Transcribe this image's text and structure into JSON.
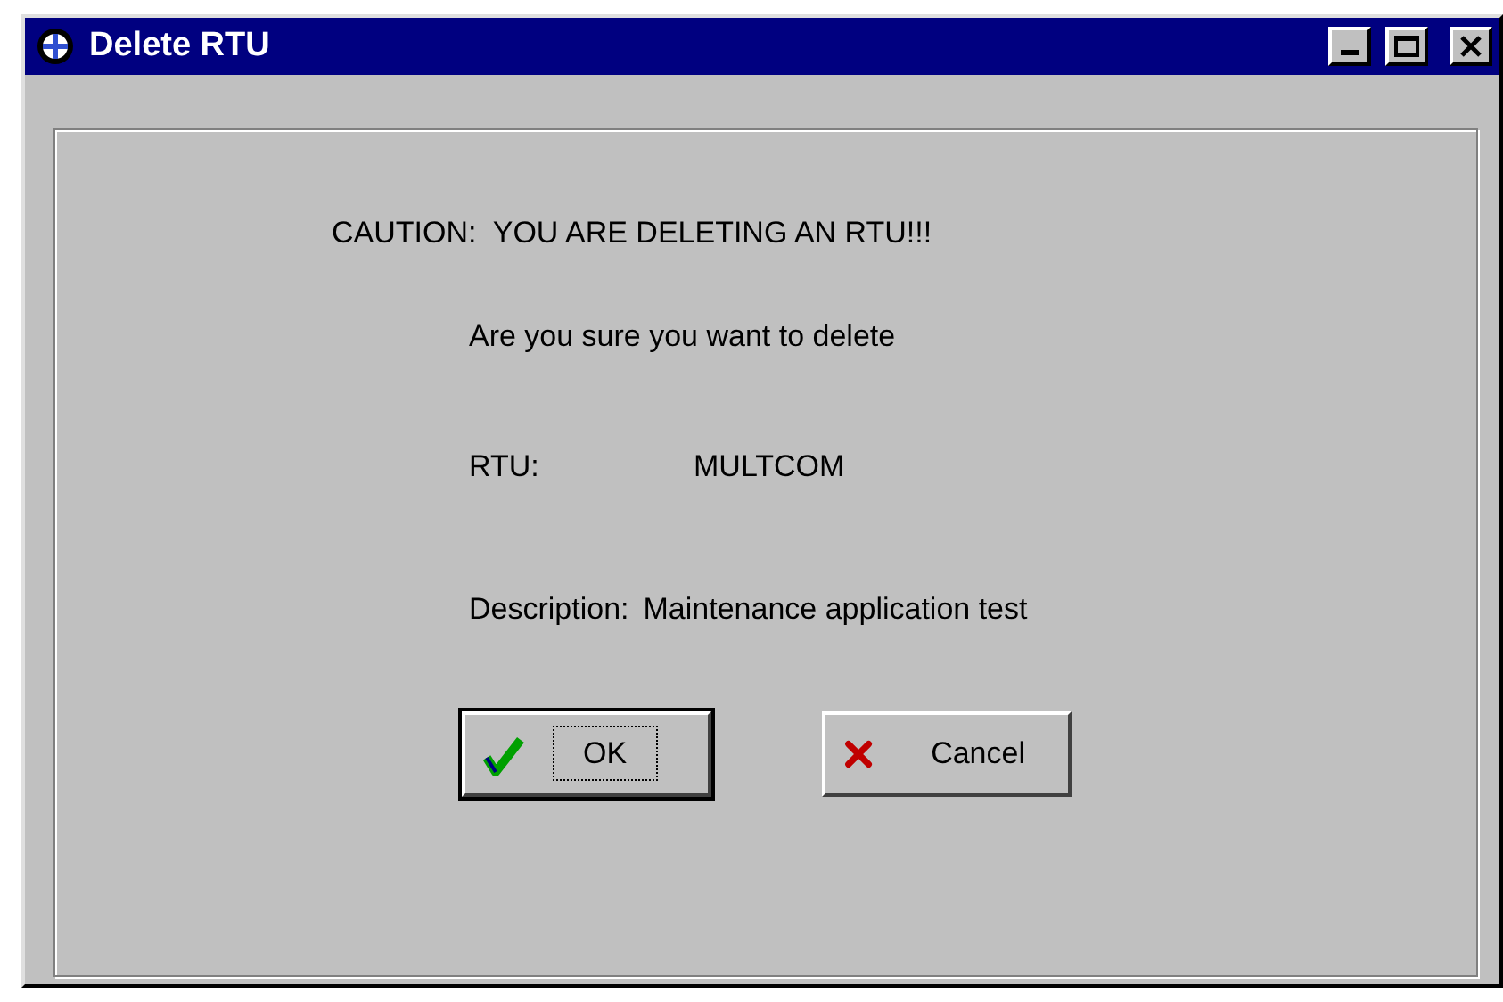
{
  "window": {
    "title": "Delete RTU"
  },
  "message": {
    "caution": "CAUTION:  YOU ARE DELETING AN RTU!!!",
    "question": "Are you sure you want to delete",
    "fields": [
      {
        "label": "RTU:",
        "value": "MULTCOM"
      },
      {
        "label": "Description:",
        "value": "Maintenance application test"
      }
    ]
  },
  "buttons": [
    {
      "label": "OK",
      "kind": "ok",
      "default": true
    },
    {
      "label": "Cancel",
      "kind": "cancel",
      "default": false
    }
  ]
}
